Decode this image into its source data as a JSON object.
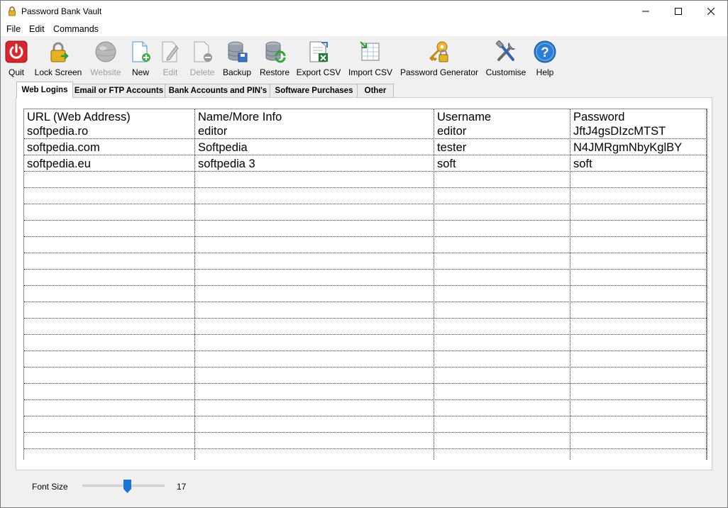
{
  "window": {
    "title": "Password Bank Vault"
  },
  "menu": [
    "File",
    "Edit",
    "Commands"
  ],
  "toolbar": [
    {
      "label": "Quit",
      "icon": "power-icon",
      "enabled": true
    },
    {
      "label": "Lock Screen",
      "icon": "lock-icon",
      "enabled": true
    },
    {
      "label": "Website",
      "icon": "globe-icon",
      "enabled": false
    },
    {
      "label": "New",
      "icon": "new-document-icon",
      "enabled": true
    },
    {
      "label": "Edit",
      "icon": "edit-document-icon",
      "enabled": false
    },
    {
      "label": "Delete",
      "icon": "delete-document-icon",
      "enabled": false
    },
    {
      "label": "Backup",
      "icon": "database-save-icon",
      "enabled": true
    },
    {
      "label": "Restore",
      "icon": "database-restore-icon",
      "enabled": true
    },
    {
      "label": "Export CSV",
      "icon": "export-csv-icon",
      "enabled": true
    },
    {
      "label": "Import CSV",
      "icon": "import-csv-icon",
      "enabled": true
    },
    {
      "label": "Password Generator",
      "icon": "key-lock-icon",
      "enabled": true
    },
    {
      "label": "Customise",
      "icon": "tools-icon",
      "enabled": true
    },
    {
      "label": "Help",
      "icon": "help-icon",
      "enabled": true
    }
  ],
  "tabs": [
    "Web Logins",
    "Email or FTP Accounts",
    "Bank Accounts and PIN's",
    "Software Purchases",
    "Other"
  ],
  "active_tab": "Web Logins",
  "table": {
    "columns": [
      "URL (Web Address)",
      "Name/More Info",
      "Username",
      "Password"
    ],
    "rows": [
      [
        "softpedia.ro",
        "editor",
        "editor",
        "JftJ4gsDIzcMTST"
      ],
      [
        "softpedia.com",
        "Softpedia",
        "tester",
        "N4JMRgmNbyKglBY"
      ],
      [
        "softpedia.eu",
        "softpedia 3",
        "soft",
        "soft"
      ]
    ]
  },
  "font_size": {
    "label": "Font Size",
    "value": "17",
    "fraction": 0.55
  },
  "colors": {
    "accent": "#1e73d8",
    "quit_red": "#d9262c",
    "help_blue": "#2a7fd4"
  }
}
